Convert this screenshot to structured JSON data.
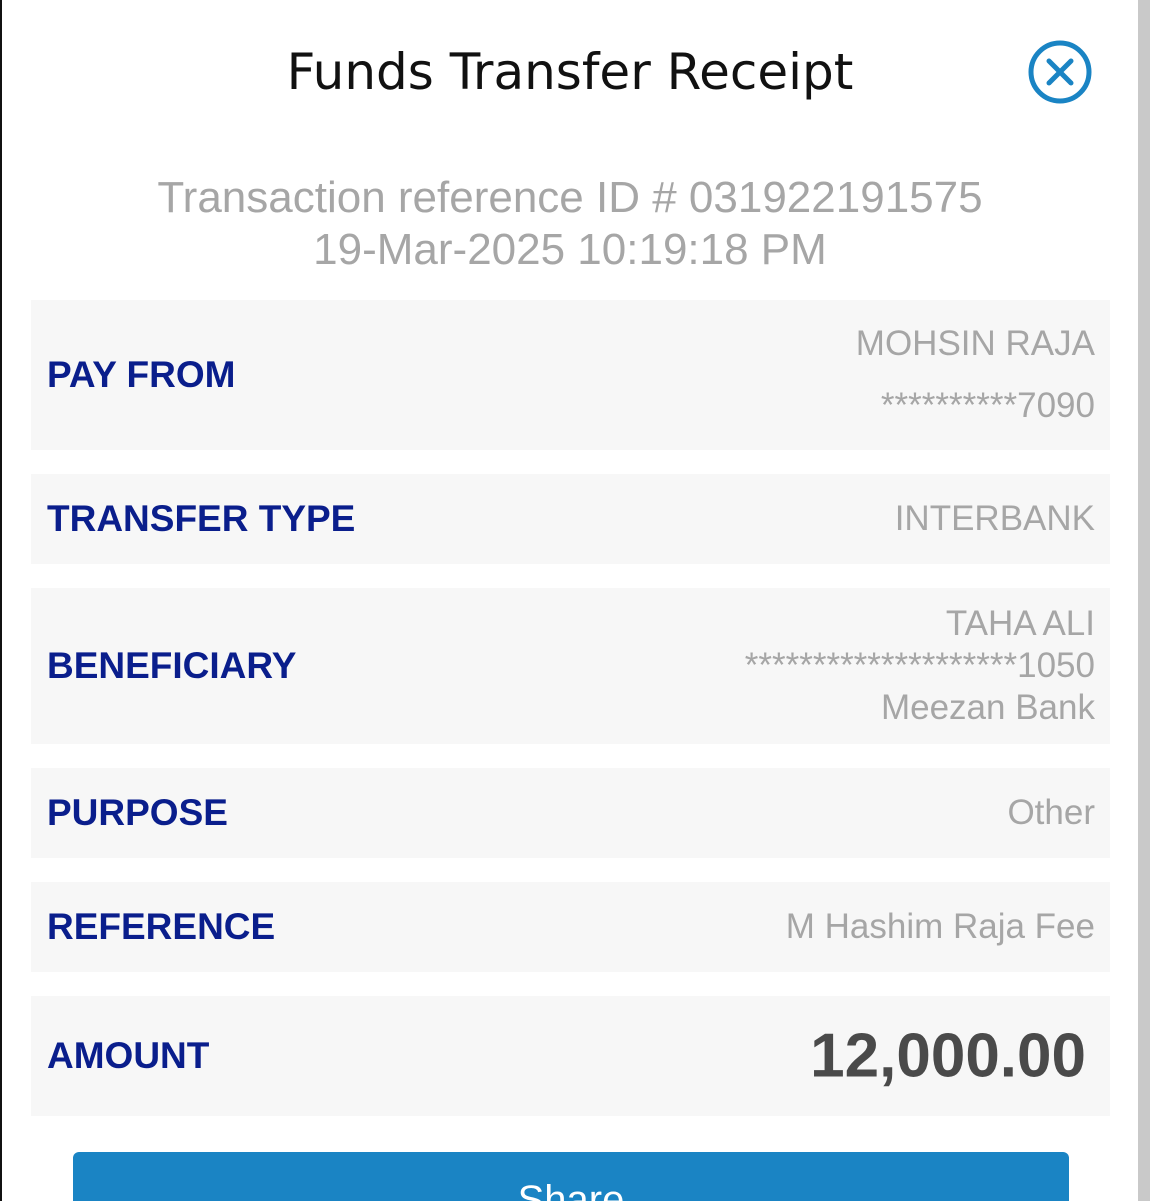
{
  "header": {
    "title": "Funds Transfer Receipt",
    "close_icon": "close-circle-icon",
    "accent_color": "#1a84c4"
  },
  "transaction": {
    "reference_line": "Transaction reference ID # 031922191575",
    "datetime": "19-Mar-2025 10:19:18 PM"
  },
  "rows": {
    "pay_from": {
      "label": "PAY FROM",
      "name": "MOHSIN RAJA",
      "account": "**********7090"
    },
    "transfer_type": {
      "label": "TRANSFER TYPE",
      "value": "INTERBANK"
    },
    "beneficiary": {
      "label": "BENEFICIARY",
      "name": "TAHA ALI",
      "account": "********************1050",
      "bank": "Meezan Bank"
    },
    "purpose": {
      "label": "PURPOSE",
      "value": "Other"
    },
    "reference": {
      "label": "REFERENCE",
      "value": "M Hashim Raja Fee"
    },
    "amount": {
      "label": "AMOUNT",
      "value": "12,000.00"
    }
  },
  "actions": {
    "share_label": "Share"
  },
  "colors": {
    "label_color": "#0a1e8c",
    "value_color": "#a6a6a6",
    "row_background": "#f7f7f7",
    "button_color": "#1a84c4"
  }
}
